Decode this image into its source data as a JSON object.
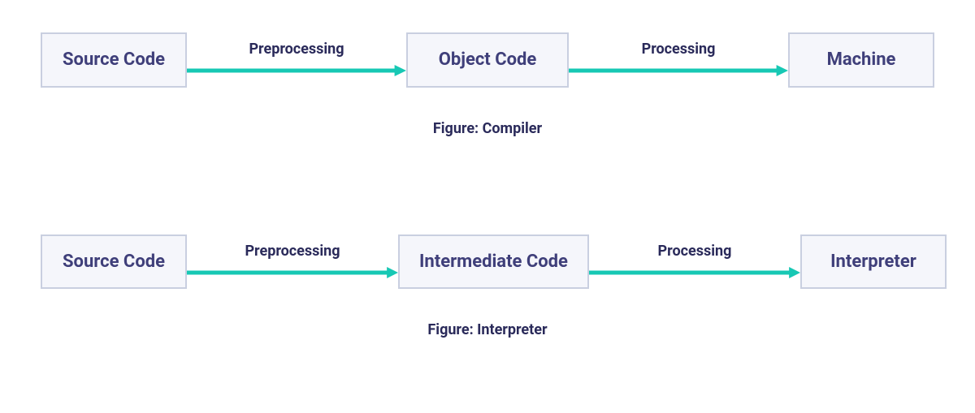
{
  "diagrams": [
    {
      "nodes": [
        "Source Code",
        "Object Code",
        "Machine"
      ],
      "arrows": [
        "Preprocessing",
        "Processing"
      ],
      "caption": "Figure: Compiler"
    },
    {
      "nodes": [
        "Source Code",
        "Intermediate Code",
        "Interpreter"
      ],
      "arrows": [
        "Preprocessing",
        "Processing"
      ],
      "caption": "Figure: Interpreter"
    }
  ],
  "colors": {
    "arrow": "#17c8b4",
    "node_bg": "#f5f6fb",
    "node_border": "#c9cfe0",
    "text_primary": "#3f3f7a",
    "text_label": "#2a2a5a"
  }
}
